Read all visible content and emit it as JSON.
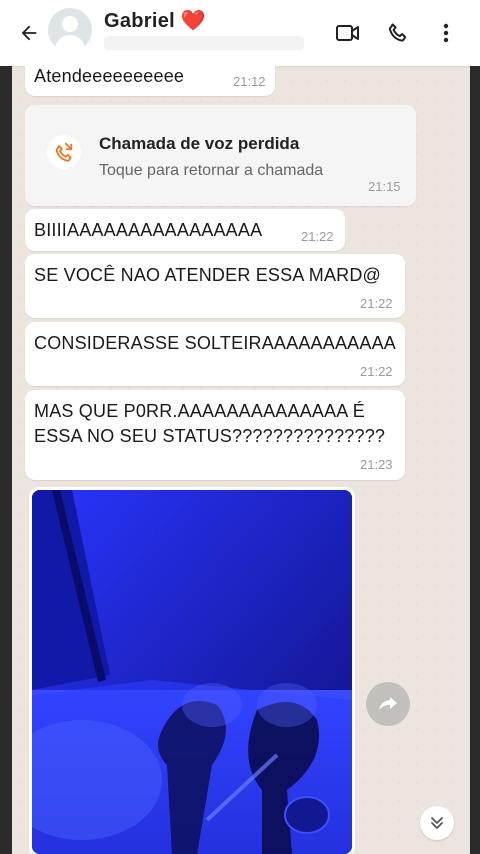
{
  "header": {
    "contact_name": "Gabriel",
    "heart_emoji": "❤️",
    "icons": [
      "back-arrow-icon",
      "video-call-icon",
      "phone-icon",
      "more-vertical-icon"
    ]
  },
  "messages": [
    {
      "text": "Atendeeeeeeeeee",
      "time": "21:12"
    },
    {
      "text": "BIIIIAAAAAAAAAAAAAAAA",
      "time": "21:22"
    },
    {
      "text": "SE VOCÊ NAO ATENDER ESSA MARD@",
      "time": "21:22"
    },
    {
      "text": "CONSIDERASSE SOLTEIRAAAAAAAAAAA",
      "time": "21:22"
    },
    {
      "text_line1": "MAS QUE P0RR.AAAAAAAAAAAAAA É",
      "text_line2": "ESSA NO SEU STATUS???????????????",
      "time": "21:23"
    }
  ],
  "missed_call": {
    "title": "Chamada de voz perdida",
    "subtitle": "Toque para retornar a chamada",
    "time": "21:15",
    "icon": "missed-call-icon"
  },
  "colors": {
    "header_bg": "#ffffff",
    "chat_bg": "#ece5dd",
    "bubble_bg": "#ffffff",
    "missed_call_accent": "#f0742c",
    "photo_blue": "#1a20c8"
  }
}
